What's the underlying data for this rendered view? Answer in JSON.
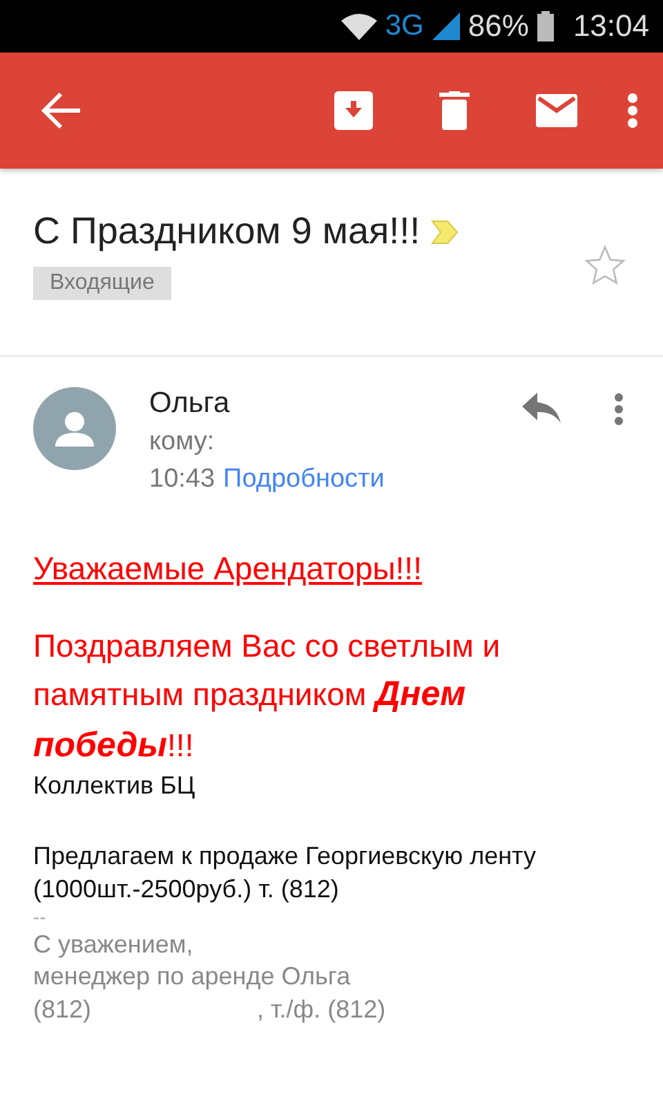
{
  "status_bar": {
    "network": "3G",
    "battery": "86%",
    "time": "13:04"
  },
  "subject": {
    "title": "С Праздником 9 мая!!!",
    "important": true,
    "label": "Входящие",
    "starred": false
  },
  "message": {
    "sender": "Ольга",
    "to": "кому:",
    "time": "10:43",
    "details_link": "Подробности"
  },
  "body": {
    "greeting": "Уважаемые Арендаторы!!!",
    "congrats": "Поздравляем Вас со светлым и памятным праздником **Днем победы**!!!",
    "signed": "Коллектив БЦ",
    "offer": [
      "Предлагаем к продаже Георгиевскую ленту",
      "(1000шт.-2500руб.) т. (812)"
    ],
    "signature_separator": "--",
    "signature": [
      [
        "С уважением,"
      ],
      [
        "менеджер по аренде Ольга"
      ],
      [
        "(812)",
        ", т./ф. (812)"
      ]
    ]
  }
}
